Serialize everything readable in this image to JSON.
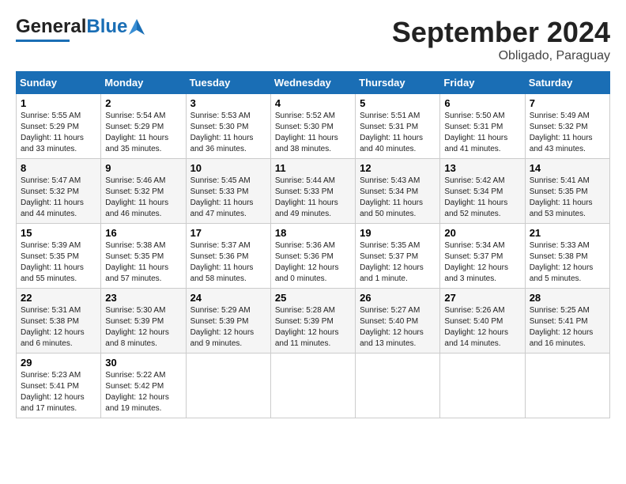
{
  "header": {
    "logo_general": "General",
    "logo_blue": "Blue",
    "month_title": "September 2024",
    "subtitle": "Obligado, Paraguay"
  },
  "weekdays": [
    "Sunday",
    "Monday",
    "Tuesday",
    "Wednesday",
    "Thursday",
    "Friday",
    "Saturday"
  ],
  "weeks": [
    [
      {
        "day": "1",
        "sunrise": "5:55 AM",
        "sunset": "5:29 PM",
        "daylight": "11 hours and 33 minutes."
      },
      {
        "day": "2",
        "sunrise": "5:54 AM",
        "sunset": "5:29 PM",
        "daylight": "11 hours and 35 minutes."
      },
      {
        "day": "3",
        "sunrise": "5:53 AM",
        "sunset": "5:30 PM",
        "daylight": "11 hours and 36 minutes."
      },
      {
        "day": "4",
        "sunrise": "5:52 AM",
        "sunset": "5:30 PM",
        "daylight": "11 hours and 38 minutes."
      },
      {
        "day": "5",
        "sunrise": "5:51 AM",
        "sunset": "5:31 PM",
        "daylight": "11 hours and 40 minutes."
      },
      {
        "day": "6",
        "sunrise": "5:50 AM",
        "sunset": "5:31 PM",
        "daylight": "11 hours and 41 minutes."
      },
      {
        "day": "7",
        "sunrise": "5:49 AM",
        "sunset": "5:32 PM",
        "daylight": "11 hours and 43 minutes."
      }
    ],
    [
      {
        "day": "8",
        "sunrise": "5:47 AM",
        "sunset": "5:32 PM",
        "daylight": "11 hours and 44 minutes."
      },
      {
        "day": "9",
        "sunrise": "5:46 AM",
        "sunset": "5:32 PM",
        "daylight": "11 hours and 46 minutes."
      },
      {
        "day": "10",
        "sunrise": "5:45 AM",
        "sunset": "5:33 PM",
        "daylight": "11 hours and 47 minutes."
      },
      {
        "day": "11",
        "sunrise": "5:44 AM",
        "sunset": "5:33 PM",
        "daylight": "11 hours and 49 minutes."
      },
      {
        "day": "12",
        "sunrise": "5:43 AM",
        "sunset": "5:34 PM",
        "daylight": "11 hours and 50 minutes."
      },
      {
        "day": "13",
        "sunrise": "5:42 AM",
        "sunset": "5:34 PM",
        "daylight": "11 hours and 52 minutes."
      },
      {
        "day": "14",
        "sunrise": "5:41 AM",
        "sunset": "5:35 PM",
        "daylight": "11 hours and 53 minutes."
      }
    ],
    [
      {
        "day": "15",
        "sunrise": "5:39 AM",
        "sunset": "5:35 PM",
        "daylight": "11 hours and 55 minutes."
      },
      {
        "day": "16",
        "sunrise": "5:38 AM",
        "sunset": "5:35 PM",
        "daylight": "11 hours and 57 minutes."
      },
      {
        "day": "17",
        "sunrise": "5:37 AM",
        "sunset": "5:36 PM",
        "daylight": "11 hours and 58 minutes."
      },
      {
        "day": "18",
        "sunrise": "5:36 AM",
        "sunset": "5:36 PM",
        "daylight": "12 hours and 0 minutes."
      },
      {
        "day": "19",
        "sunrise": "5:35 AM",
        "sunset": "5:37 PM",
        "daylight": "12 hours and 1 minute."
      },
      {
        "day": "20",
        "sunrise": "5:34 AM",
        "sunset": "5:37 PM",
        "daylight": "12 hours and 3 minutes."
      },
      {
        "day": "21",
        "sunrise": "5:33 AM",
        "sunset": "5:38 PM",
        "daylight": "12 hours and 5 minutes."
      }
    ],
    [
      {
        "day": "22",
        "sunrise": "5:31 AM",
        "sunset": "5:38 PM",
        "daylight": "12 hours and 6 minutes."
      },
      {
        "day": "23",
        "sunrise": "5:30 AM",
        "sunset": "5:39 PM",
        "daylight": "12 hours and 8 minutes."
      },
      {
        "day": "24",
        "sunrise": "5:29 AM",
        "sunset": "5:39 PM",
        "daylight": "12 hours and 9 minutes."
      },
      {
        "day": "25",
        "sunrise": "5:28 AM",
        "sunset": "5:39 PM",
        "daylight": "12 hours and 11 minutes."
      },
      {
        "day": "26",
        "sunrise": "5:27 AM",
        "sunset": "5:40 PM",
        "daylight": "12 hours and 13 minutes."
      },
      {
        "day": "27",
        "sunrise": "5:26 AM",
        "sunset": "5:40 PM",
        "daylight": "12 hours and 14 minutes."
      },
      {
        "day": "28",
        "sunrise": "5:25 AM",
        "sunset": "5:41 PM",
        "daylight": "12 hours and 16 minutes."
      }
    ],
    [
      {
        "day": "29",
        "sunrise": "5:23 AM",
        "sunset": "5:41 PM",
        "daylight": "12 hours and 17 minutes."
      },
      {
        "day": "30",
        "sunrise": "5:22 AM",
        "sunset": "5:42 PM",
        "daylight": "12 hours and 19 minutes."
      },
      null,
      null,
      null,
      null,
      null
    ]
  ]
}
